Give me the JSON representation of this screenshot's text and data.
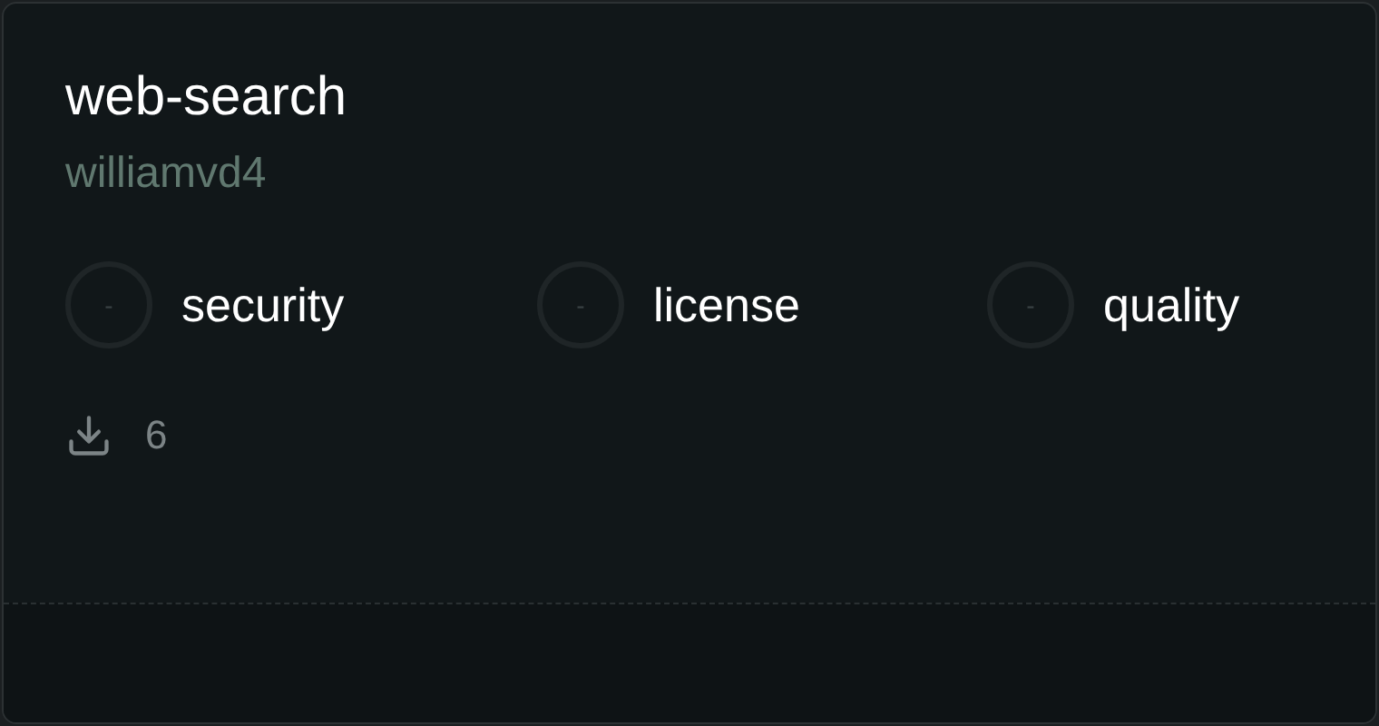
{
  "card": {
    "title": "web-search",
    "author": "williamvd4",
    "scores": [
      {
        "value": "-",
        "label": "security"
      },
      {
        "value": "-",
        "label": "license"
      },
      {
        "value": "-",
        "label": "quality"
      }
    ],
    "downloads": "6"
  }
}
